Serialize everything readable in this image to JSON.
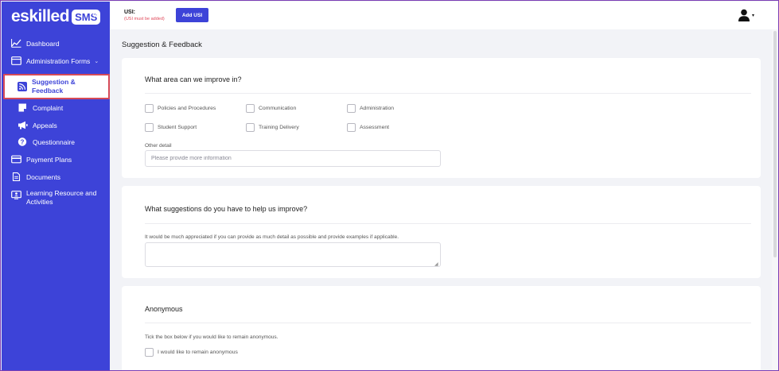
{
  "brand": {
    "name": "eskilled",
    "badge": "SMS",
    "collapse_icon": "double-chevron-left-icon"
  },
  "sidebar": {
    "items": [
      {
        "label": "Dashboard",
        "icon": "chart-line-icon"
      },
      {
        "label": "Administration Forms",
        "icon": "browser-window-icon"
      },
      {
        "label": "Suggestion & Feedback",
        "icon": "rss-icon",
        "active": true
      },
      {
        "label": "Complaint",
        "icon": "note-icon"
      },
      {
        "label": "Appeals",
        "icon": "megaphone-icon"
      },
      {
        "label": "Questionnaire",
        "icon": "question-circle-icon"
      },
      {
        "label": "Payment Plans",
        "icon": "credit-card-icon"
      },
      {
        "label": "Documents",
        "icon": "document-icon"
      },
      {
        "label": "Learning Resource and Activities",
        "icon": "user-screen-icon"
      }
    ],
    "active_line1": "Suggestion &",
    "active_line2": "Feedback",
    "learning_line1": "Learning Resource and",
    "learning_line2": "Activities"
  },
  "topbar": {
    "usi_label": "USI:",
    "usi_note": "(USI must be added)",
    "add_usi_label": "Add USI",
    "user_icon": "user-icon"
  },
  "page": {
    "title": "Suggestion & Feedback"
  },
  "card1": {
    "title": "What area can we improve in?",
    "options": [
      "Policies and Procedures",
      "Communication",
      "Administration",
      "Student Support",
      "Training Delivery",
      "Assessment"
    ],
    "other_label": "Other detail",
    "other_placeholder": "Please provide more information"
  },
  "card2": {
    "title": "What suggestions do you have to help us improve?",
    "hint": "It would be much appreciated if you can provide as much detail as possible and provide examples if applicable."
  },
  "card3": {
    "title": "Anonymous",
    "hint": "Tick the box below if you would like to remain anonymous.",
    "checkbox_label": "I would like to remain anonymous"
  },
  "colors": {
    "sidebar": "#3d43d8",
    "accent": "#3d43d8",
    "active_border": "#d64a57",
    "usi_note": "#e04a5c"
  }
}
